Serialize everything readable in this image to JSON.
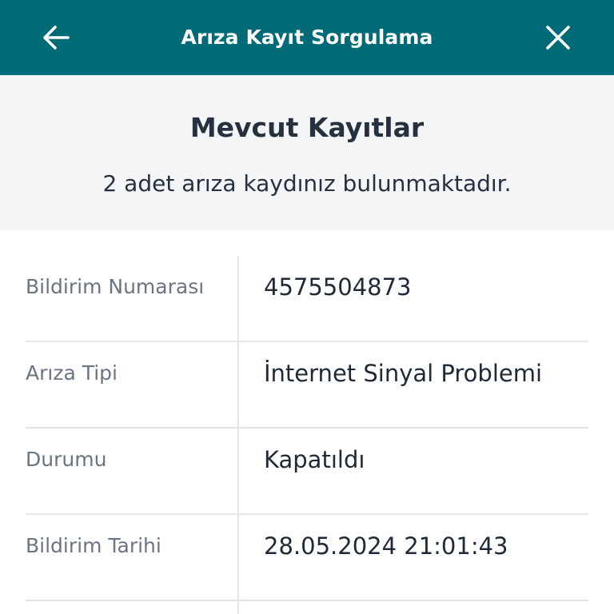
{
  "colors": {
    "header_bg": "#006b77",
    "summary_bg": "#f4f5f6",
    "text_dark": "#26303f",
    "text_muted": "#6b7482",
    "divider": "#e3e5e8"
  },
  "header": {
    "title": "Arıza Kayıt Sorgulama",
    "back_icon": "arrow-left-icon",
    "close_icon": "close-icon"
  },
  "summary": {
    "heading": "Mevcut Kayıtlar",
    "subtitle": "2 adet arıza kaydınız bulunmaktadır."
  },
  "record": {
    "rows": [
      {
        "label": "Bildirim Numarası",
        "value": "4575504873"
      },
      {
        "label": "Arıza Tipi",
        "value": "İnternet Sinyal Problemi"
      },
      {
        "label": "Durumu",
        "value": "Kapatıldı"
      },
      {
        "label": "Bildirim Tarihi",
        "value": "28.05.2024 21:01:43"
      }
    ]
  }
}
